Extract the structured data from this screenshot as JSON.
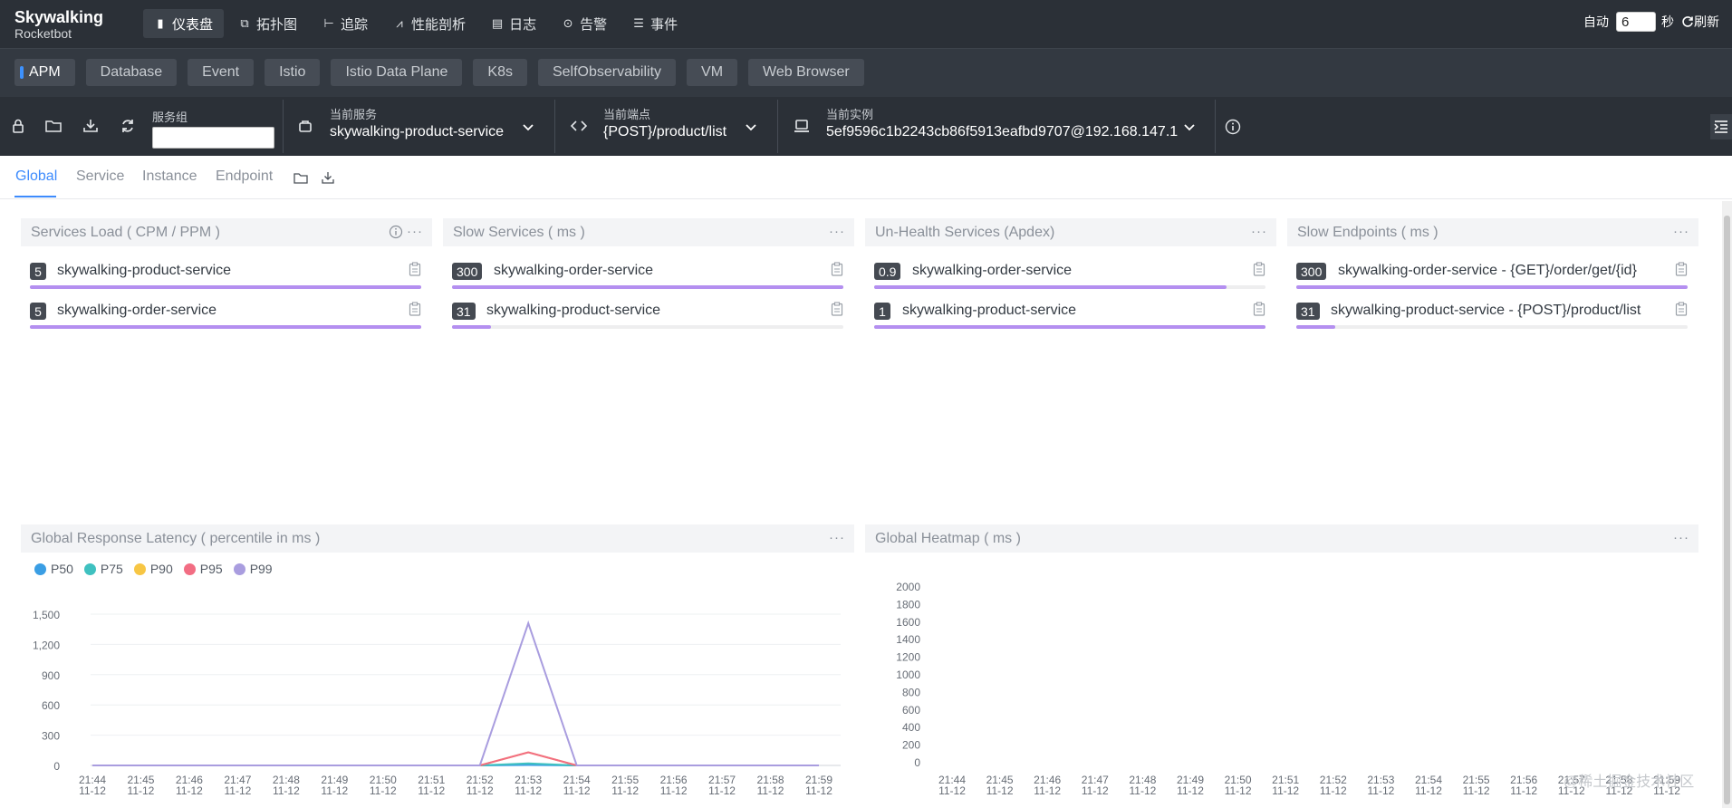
{
  "app": {
    "logo_line1": "Skywalking",
    "logo_line2": "Rocketbot"
  },
  "nav": {
    "items": [
      {
        "label": "仪表盘",
        "icon": "dashboard-icon",
        "active": true
      },
      {
        "label": "拓扑图",
        "icon": "topology-icon"
      },
      {
        "label": "追踪",
        "icon": "trace-icon"
      },
      {
        "label": "性能剖析",
        "icon": "profile-icon"
      },
      {
        "label": "日志",
        "icon": "log-icon"
      },
      {
        "label": "告警",
        "icon": "alarm-icon"
      },
      {
        "label": "事件",
        "icon": "event-icon"
      }
    ],
    "auto_label": "自动",
    "interval_value": "6",
    "seconds_label": "秒",
    "refresh_label": "刷新"
  },
  "templates": [
    "APM",
    "Database",
    "Event",
    "Istio",
    "Istio Data Plane",
    "K8s",
    "SelfObservability",
    "VM",
    "Web Browser"
  ],
  "toolbar": {
    "group_label": "服务组",
    "group_value": "",
    "service_label": "当前服务",
    "service_value": "skywalking-product-service",
    "endpoint_label": "当前端点",
    "endpoint_value": "{POST}/product/list",
    "instance_label": "当前实例",
    "instance_value": "5ef9596c1b2243cb86f5913eafbd9707@192.168.147.1"
  },
  "dash_tabs": [
    "Global",
    "Service",
    "Instance",
    "Endpoint"
  ],
  "panels": {
    "services_load": {
      "title": "Services Load ( CPM / PPM )",
      "rows": [
        {
          "value": "5",
          "name": "skywalking-product-service",
          "fraction": 1.0
        },
        {
          "value": "5",
          "name": "skywalking-order-service",
          "fraction": 1.0
        }
      ]
    },
    "slow_services": {
      "title": "Slow Services ( ms )",
      "rows": [
        {
          "value": "300",
          "name": "skywalking-order-service",
          "fraction": 1.0
        },
        {
          "value": "31",
          "name": "skywalking-product-service",
          "fraction": 0.1
        }
      ]
    },
    "unhealth_services": {
      "title": "Un-Health Services (Apdex)",
      "rows": [
        {
          "value": "0.9",
          "name": "skywalking-order-service",
          "fraction": 0.9
        },
        {
          "value": "1",
          "name": "skywalking-product-service",
          "fraction": 1.0
        }
      ]
    },
    "slow_endpoints": {
      "title": "Slow Endpoints ( ms )",
      "rows": [
        {
          "value": "300",
          "name": "skywalking-order-service - {GET}/order/get/{id}",
          "fraction": 1.0
        },
        {
          "value": "31",
          "name": "skywalking-product-service - {POST}/product/list",
          "fraction": 0.1
        }
      ]
    },
    "latency_title": "Global Response Latency ( percentile in ms )",
    "heatmap_title": "Global Heatmap ( ms )"
  },
  "chart_data": [
    {
      "type": "line",
      "title": "Global Response Latency ( percentile in ms )",
      "x": [
        "21:44\n11-12",
        "21:45\n11-12",
        "21:46\n11-12",
        "21:47\n11-12",
        "21:48\n11-12",
        "21:49\n11-12",
        "21:50\n11-12",
        "21:51\n11-12",
        "21:52\n11-12",
        "21:53\n11-12",
        "21:54\n11-12",
        "21:55\n11-12",
        "21:56\n11-12",
        "21:57\n11-12",
        "21:58\n11-12",
        "21:59\n11-12"
      ],
      "yticks": [
        "0",
        "300",
        "600",
        "900",
        "1,200",
        "1,500"
      ],
      "ylim": [
        0,
        1500
      ],
      "legend_position": "top-left",
      "series": [
        {
          "name": "P50",
          "color": "#3a9ee4",
          "values": [
            0,
            0,
            0,
            0,
            0,
            0,
            0,
            0,
            0,
            5,
            0,
            0,
            0,
            0,
            0,
            0
          ]
        },
        {
          "name": "P75",
          "color": "#3fc1c0",
          "values": [
            0,
            0,
            0,
            0,
            0,
            0,
            0,
            0,
            0,
            20,
            0,
            0,
            0,
            0,
            0,
            0
          ]
        },
        {
          "name": "P90",
          "color": "#f7c644",
          "values": [
            0,
            0,
            0,
            0,
            0,
            0,
            0,
            0,
            0,
            130,
            0,
            0,
            0,
            0,
            0,
            0
          ]
        },
        {
          "name": "P95",
          "color": "#f26d83",
          "values": [
            0,
            0,
            0,
            0,
            0,
            0,
            0,
            0,
            0,
            130,
            0,
            0,
            0,
            0,
            0,
            0
          ]
        },
        {
          "name": "P99",
          "color": "#a99ddf",
          "values": [
            0,
            0,
            0,
            0,
            0,
            0,
            0,
            0,
            0,
            1410,
            0,
            0,
            0,
            0,
            0,
            0
          ]
        }
      ]
    },
    {
      "type": "heatmap",
      "title": "Global Heatmap ( ms )",
      "x": [
        "21:44\n11-12",
        "21:45\n11-12",
        "21:46\n11-12",
        "21:47\n11-12",
        "21:48\n11-12",
        "21:49\n11-12",
        "21:50\n11-12",
        "21:51\n11-12",
        "21:52\n11-12",
        "21:53\n11-12",
        "21:54\n11-12",
        "21:55\n11-12",
        "21:56\n11-12",
        "21:57\n11-12",
        "21:58\n11-12",
        "21:59\n11-12"
      ],
      "yticks": [
        "0",
        "200",
        "400",
        "600",
        "800",
        "1000",
        "1200",
        "1400",
        "1600",
        "1800",
        "2000"
      ],
      "ylim": [
        0,
        2000
      ]
    }
  ],
  "watermark": "@稀土掘金技术社区"
}
